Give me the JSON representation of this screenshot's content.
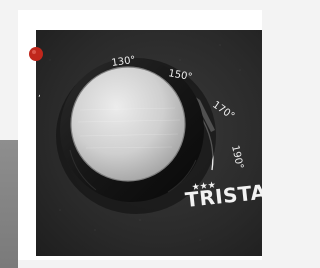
{
  "temperature_dial": {
    "scale_labels": [
      "130°",
      "150°",
      "170°",
      "190°"
    ]
  },
  "brand": {
    "name": "TRISTA",
    "stars": "★★★"
  },
  "indicator_light": {
    "color": "#c0271c"
  },
  "colors": {
    "appliance_body": "#2a2a2a",
    "knob_cap": "#c9c9c9",
    "knob_ring": "#1c1c1c",
    "scale_marks": "#efefef"
  }
}
